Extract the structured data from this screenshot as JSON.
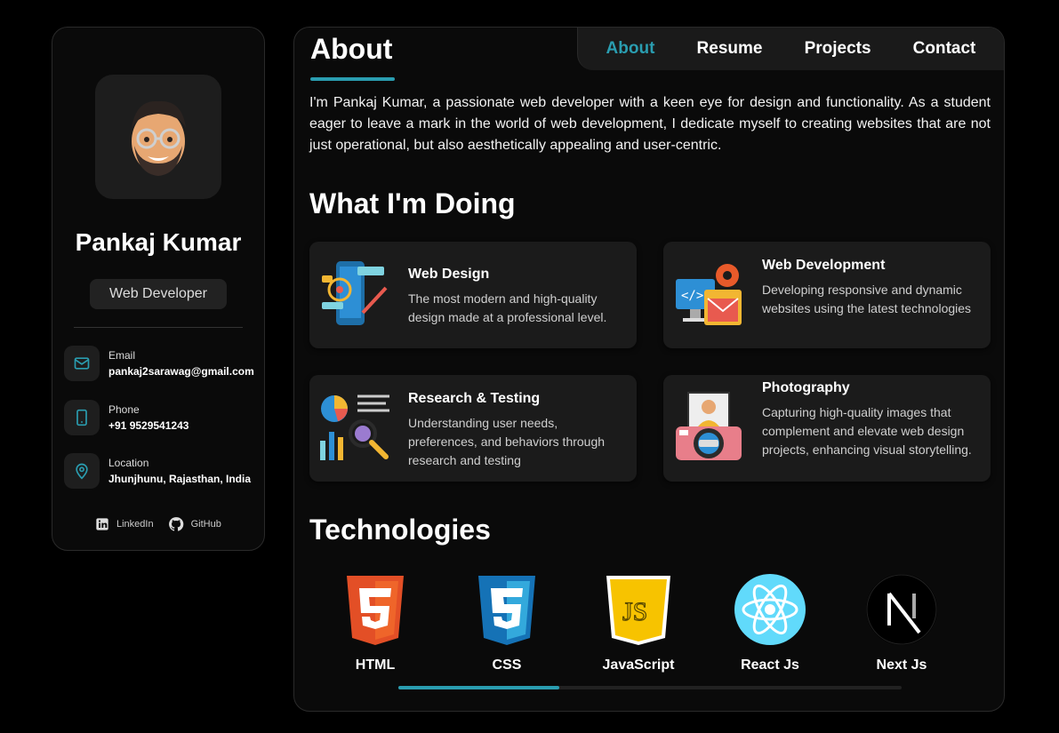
{
  "sidebar": {
    "name": "Pankaj Kumar",
    "role": "Web Developer",
    "contacts": [
      {
        "icon": "mail-icon",
        "label": "Email",
        "value": "pankaj2sarawag@gmail.com"
      },
      {
        "icon": "phone-icon",
        "label": "Phone",
        "value": "+91 9529541243"
      },
      {
        "icon": "location-icon",
        "label": "Location",
        "value": "Jhunjhunu, Rajasthan, India"
      }
    ],
    "social": [
      {
        "icon": "linkedin-icon",
        "label": "LinkedIn"
      },
      {
        "icon": "github-icon",
        "label": "GitHub"
      }
    ]
  },
  "nav": {
    "items": [
      "About",
      "Resume",
      "Projects",
      "Contact"
    ],
    "active": "About"
  },
  "page": {
    "title": "About",
    "about": "I'm Pankaj Kumar, a passionate web developer with a keen eye for design and functionality. As a student eager to leave a mark in the world of web development, I dedicate myself to creating websites that are not just operational, but also aesthetically appealing and user-centric."
  },
  "doing": {
    "heading": "What I'm Doing",
    "services": [
      {
        "title": "Web Design",
        "desc": "The most modern and high-quality design made at a professional level.",
        "icon": "web-design-icon"
      },
      {
        "title": "Web Development",
        "desc": "Developing responsive and dynamic websites using the latest technologies",
        "icon": "web-development-icon"
      },
      {
        "title": "Research & Testing",
        "desc": "Understanding user needs, preferences, and behaviors through research and testing",
        "icon": "research-testing-icon"
      },
      {
        "title": "Photography",
        "desc": "Capturing high-quality images that complement and elevate web design projects, enhancing visual storytelling.",
        "icon": "photography-icon"
      }
    ]
  },
  "tech": {
    "heading": "Technologies",
    "items": [
      {
        "label": "HTML",
        "icon": "html5-icon"
      },
      {
        "label": "CSS",
        "icon": "css3-icon"
      },
      {
        "label": "JavaScript",
        "icon": "javascript-icon"
      },
      {
        "label": "React Js",
        "icon": "react-icon"
      },
      {
        "label": "Next Js",
        "icon": "nextjs-icon"
      }
    ],
    "scroll_fraction": 0.32
  },
  "colors": {
    "accent": "#2a9db0",
    "background": "#000000",
    "card": "#1b1b1b"
  }
}
